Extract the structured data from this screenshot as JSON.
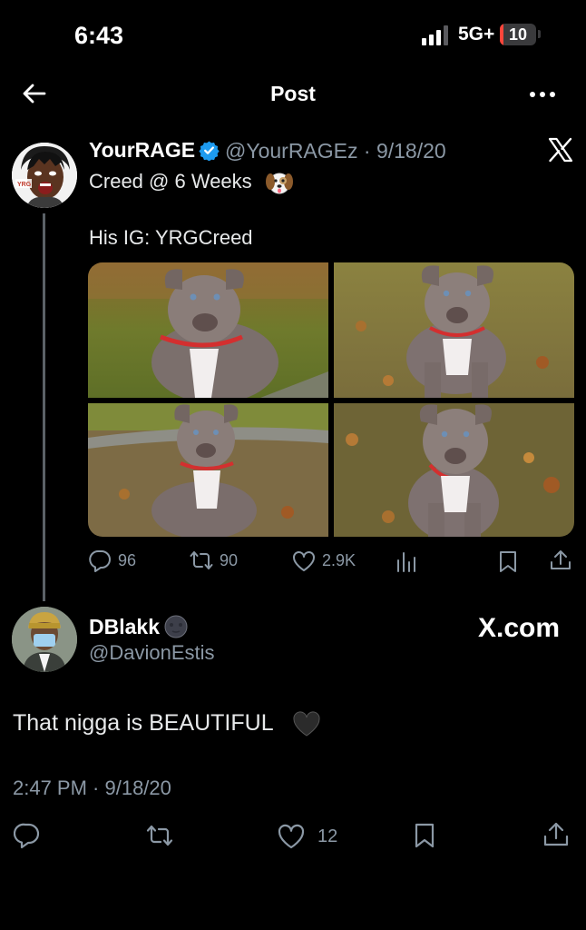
{
  "status_bar": {
    "time": "6:43",
    "network": "5G+",
    "battery": "10",
    "battery_fraction": 0.1,
    "battery_color": "#ff453a"
  },
  "header": {
    "back_icon": "arrow-left-icon",
    "title": "Post",
    "more_icon": "more-horizontal-icon"
  },
  "quoted_post": {
    "display_name": "YourRAGE",
    "verified_icon": "verified-badge-icon",
    "verified_color": "#1d9bf0",
    "handle_date": "@YourRAGEz · 9/18/20",
    "platform_icon": "x-logo-icon",
    "text_line1": "Creed @ 6 Weeks",
    "text_emoji": "dog-face-emoji-icon",
    "text_line2": "His IG: YRGCreed",
    "media": [
      "puppy-photo-1",
      "puppy-photo-2",
      "puppy-photo-3",
      "puppy-photo-4"
    ],
    "actions": {
      "replies": "96",
      "reposts": "90",
      "likes": "2.9K"
    }
  },
  "reply_post": {
    "display_name": "DBlakk",
    "name_emoji": "new-moon-face-emoji-icon",
    "handle": "@DavionEstis",
    "watermark": "X.com",
    "text": "That nigga is BEAUTIFUL",
    "text_emoji": "black-heart-emoji-icon",
    "timestamp": "2:47 PM · 9/18/20",
    "actions": {
      "likes": "12"
    }
  }
}
